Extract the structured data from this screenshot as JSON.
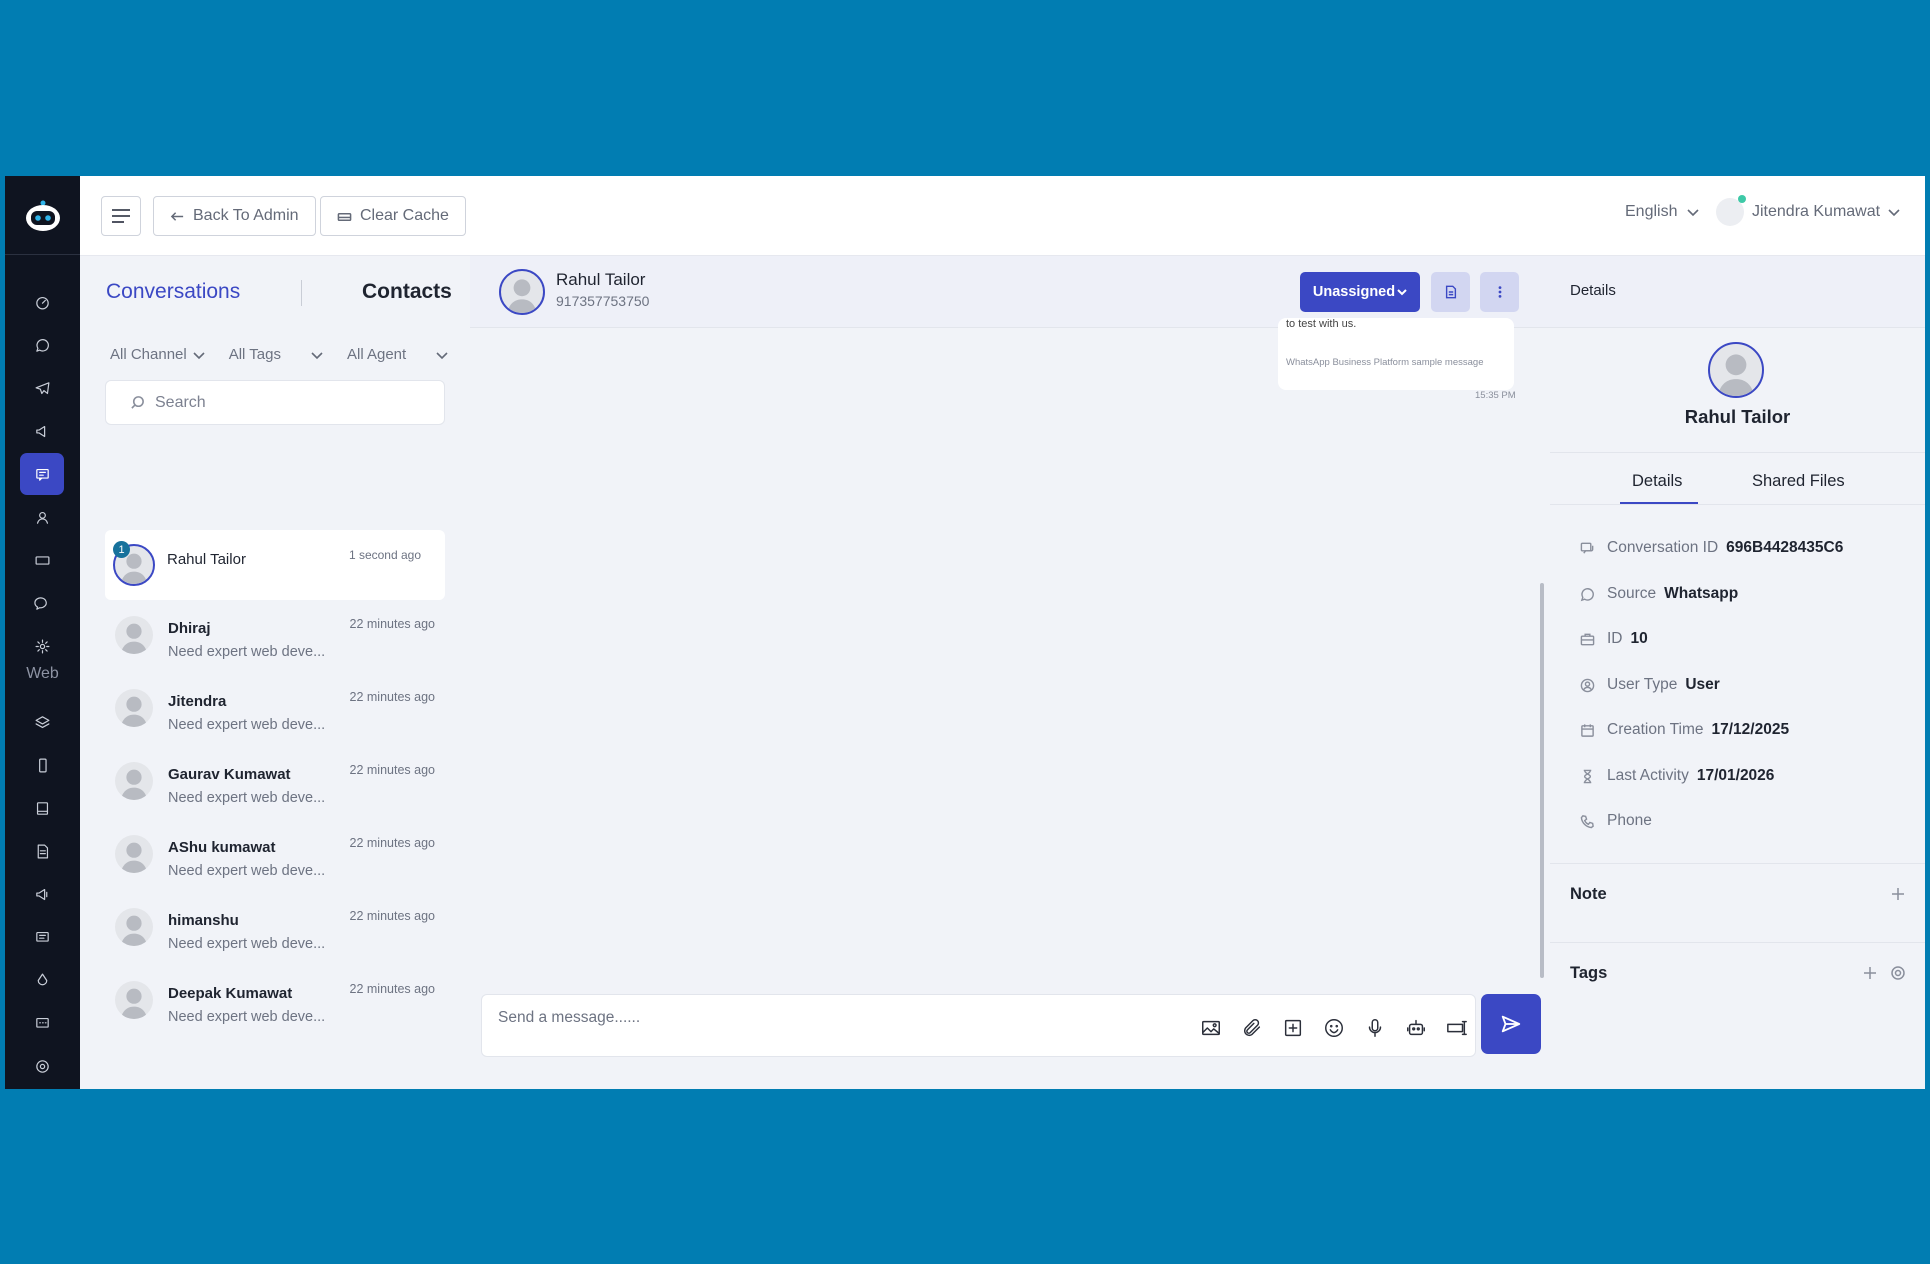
{
  "topbar": {
    "back_label": "Back To Admin",
    "clear_label": "Clear Cache",
    "language": "English",
    "user_name": "Jitendra Kumawat"
  },
  "sidebar": {
    "web_label": "Web",
    "icons": [
      "dashboard-icon",
      "whatsapp-icon",
      "telegram-icon",
      "campaign-icon",
      "chat-icon",
      "contacts-icon",
      "ticket-icon",
      "message-icon",
      "settings-icon",
      "layers-icon",
      "mobile-icon",
      "book-icon",
      "document-icon",
      "megaphone-icon",
      "comment-icon",
      "drop-icon",
      "chat-bubble-icon",
      "gear-icon"
    ]
  },
  "list": {
    "tab_conversations": "Conversations",
    "tab_contacts": "Contacts",
    "filter_channel": "All Channel",
    "filter_tags": "All Tags",
    "filter_agent": "All Agent",
    "search_placeholder": "Search",
    "items": [
      {
        "name": "Rahul Tailor",
        "time": "1 second ago",
        "msg": "",
        "badge": "1"
      },
      {
        "name": "Dhiraj",
        "time": "22 minutes ago",
        "msg": "Need expert web deve..."
      },
      {
        "name": "Jitendra",
        "time": "22 minutes ago",
        "msg": "Need expert web deve..."
      },
      {
        "name": "Gaurav Kumawat",
        "time": "22 minutes ago",
        "msg": "Need expert web deve..."
      },
      {
        "name": "AShu kumawat",
        "time": "22 minutes ago",
        "msg": "Need expert web deve..."
      },
      {
        "name": "himanshu",
        "time": "22 minutes ago",
        "msg": "Need expert web deve..."
      },
      {
        "name": "Deepak Kumawat",
        "time": "22 minutes ago",
        "msg": "Need expert web deve..."
      }
    ]
  },
  "chat": {
    "name": "Rahul Tailor",
    "phone": "917357753750",
    "assign_label": "Unassigned",
    "message_text": "to test with us.",
    "message_footer": "WhatsApp Business Platform sample message",
    "message_time": "15:35 PM",
    "composer_placeholder": "Send a message......"
  },
  "details": {
    "header": "Details",
    "name": "Rahul Tailor",
    "tab_details": "Details",
    "tab_files": "Shared Files",
    "fields": [
      {
        "label": "Conversation ID",
        "value": "696B4428435C6"
      },
      {
        "label": "Source",
        "value": "Whatsapp"
      },
      {
        "label": "ID",
        "value": "10"
      },
      {
        "label": "User Type",
        "value": "User"
      },
      {
        "label": "Creation Time",
        "value": "17/12/2025"
      },
      {
        "label": "Last Activity",
        "value": "17/01/2026"
      },
      {
        "label": "Phone",
        "value": ""
      }
    ],
    "note_title": "Note",
    "tags_title": "Tags"
  },
  "colors": {
    "accent": "#3b48c4",
    "background": "#017db2",
    "rail": "#0f1420"
  }
}
